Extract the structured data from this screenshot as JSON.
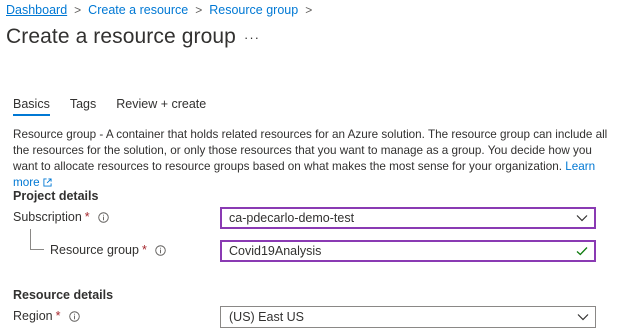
{
  "breadcrumb": {
    "items": [
      "Dashboard",
      "Create a resource",
      "Resource group"
    ]
  },
  "header": {
    "title": "Create a resource group",
    "more_label": "···"
  },
  "tabs": [
    {
      "label": "Basics",
      "active": true
    },
    {
      "label": "Tags",
      "active": false
    },
    {
      "label": "Review + create",
      "active": false
    }
  ],
  "description": {
    "lead": "Resource group",
    "text": " - A container that holds related resources for an Azure solution. The resource group can include all the resources for the solution, or only those resources that you want to manage as a group. You decide how you want to allocate resources to resource groups based on what makes the most sense for your organization. ",
    "link": "Learn more"
  },
  "project_details": {
    "title": "Project details",
    "subscription": {
      "label": "Subscription",
      "required": "*",
      "value": "ca-pdecarlo-demo-test"
    },
    "resource_group": {
      "label": "Resource group",
      "required": "*",
      "value": "Covid19Analysis"
    }
  },
  "resource_details": {
    "title": "Resource details",
    "region": {
      "label": "Region",
      "required": "*",
      "value": "(US) East US"
    }
  },
  "icons": {
    "info": "info-icon",
    "external": "external-link-icon",
    "chevron": "chevron-down-icon",
    "check": "check-icon"
  },
  "colors": {
    "accent": "#0078d4",
    "focus_border": "#8a3ab3",
    "valid_check": "#107c10",
    "required": "#a4262c"
  }
}
